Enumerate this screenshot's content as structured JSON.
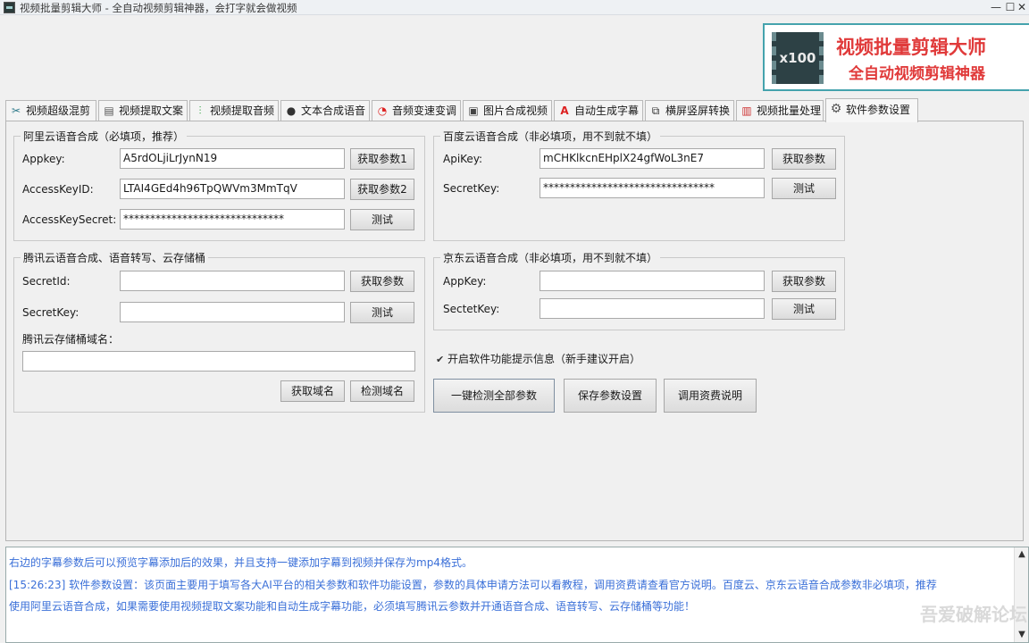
{
  "window": {
    "title": "视频批量剪辑大师 - 全自动视频剪辑神器，会打字就会做视频",
    "minimize": "—",
    "close": "✕"
  },
  "banner": {
    "badge": "x100",
    "line1": "视频批量剪辑大师",
    "line2": "全自动视频剪辑神器"
  },
  "tabs": [
    {
      "label": "视频超级混剪",
      "icon": "scissors-icon"
    },
    {
      "label": "视频提取文案",
      "icon": "document-icon"
    },
    {
      "label": "视频提取音频",
      "icon": "waveform-icon"
    },
    {
      "label": "文本合成语音",
      "icon": "microphone-icon"
    },
    {
      "label": "音频变速变调",
      "icon": "speedometer-icon"
    },
    {
      "label": "图片合成视频",
      "icon": "image-icon"
    },
    {
      "label": "自动生成字幕",
      "icon": "subtitle-icon"
    },
    {
      "label": "横屏竖屏转换",
      "icon": "rotate-screen-icon"
    },
    {
      "label": "视频批量处理",
      "icon": "film-icon"
    },
    {
      "label": "软件参数设置",
      "icon": "gear-icon"
    }
  ],
  "active_tab": "软件参数设置",
  "aliyun": {
    "title": "阿里云语音合成（必填项，推荐）",
    "appkey_label": "Appkey:",
    "appkey_value": "A5rdOLjiLrJynN19",
    "keyid_label": "AccessKeyID:",
    "keyid_value": "LTAI4GEd4h96TpQWVm3MmTqV",
    "secret_label": "AccessKeySecret:",
    "secret_value": "******************************",
    "btn_get1": "获取参数1",
    "btn_get2": "获取参数2",
    "btn_test": "测试"
  },
  "baidu": {
    "title": "百度云语音合成（非必填项，用不到就不填）",
    "apikey_label": "ApiKey:",
    "apikey_value": "mCHKlkcnEHplX24gfWoL3nE7",
    "secret_label": "SecretKey:",
    "secret_value": "********************************",
    "btn_get": "获取参数",
    "btn_test": "测试"
  },
  "tencent": {
    "title": "腾讯云语音合成、语音转写、云存储桶",
    "id_label": "SecretId:",
    "id_value": "",
    "key_label": "SecretKey:",
    "key_value": "",
    "domain_label": "腾讯云存储桶域名：",
    "domain_value": "",
    "btn_get": "获取参数",
    "btn_test": "测试",
    "btn_get_domain": "获取域名",
    "btn_check_domain": "检测域名"
  },
  "jd": {
    "title": "京东云语音合成（非必填项，用不到就不填）",
    "appkey_label": "AppKey:",
    "appkey_value": "",
    "secret_label": "SectetKey:",
    "secret_value": "",
    "btn_get": "获取参数",
    "btn_test": "测试"
  },
  "options": {
    "tips_checked": true,
    "tips_label": "开启软件功能提示信息（新手建议开启）",
    "check_mark": "✔"
  },
  "actions": {
    "check_all": "一键检测全部参数",
    "save": "保存参数设置",
    "fee_info": "调用资费说明"
  },
  "log": {
    "line1": "右边的字幕参数后可以预览字幕添加后的效果，并且支持一键添加字幕到视频并保存为mp4格式。",
    "line2": "[15:26:23] 软件参数设置：该页面主要用于填写各大AI平台的相关参数和软件功能设置，参数的具体申请方法可以看教程，调用资费请查看官方说明。百度云、京东云语音合成参数非必填项，推荐",
    "line3": "使用阿里云语音合成，如果需要使用视频提取文案功能和自动生成字幕功能，必须填写腾讯云参数并开通语音合成、语音转写、云存储桶等功能！"
  },
  "watermark": "吾爱破解论坛"
}
